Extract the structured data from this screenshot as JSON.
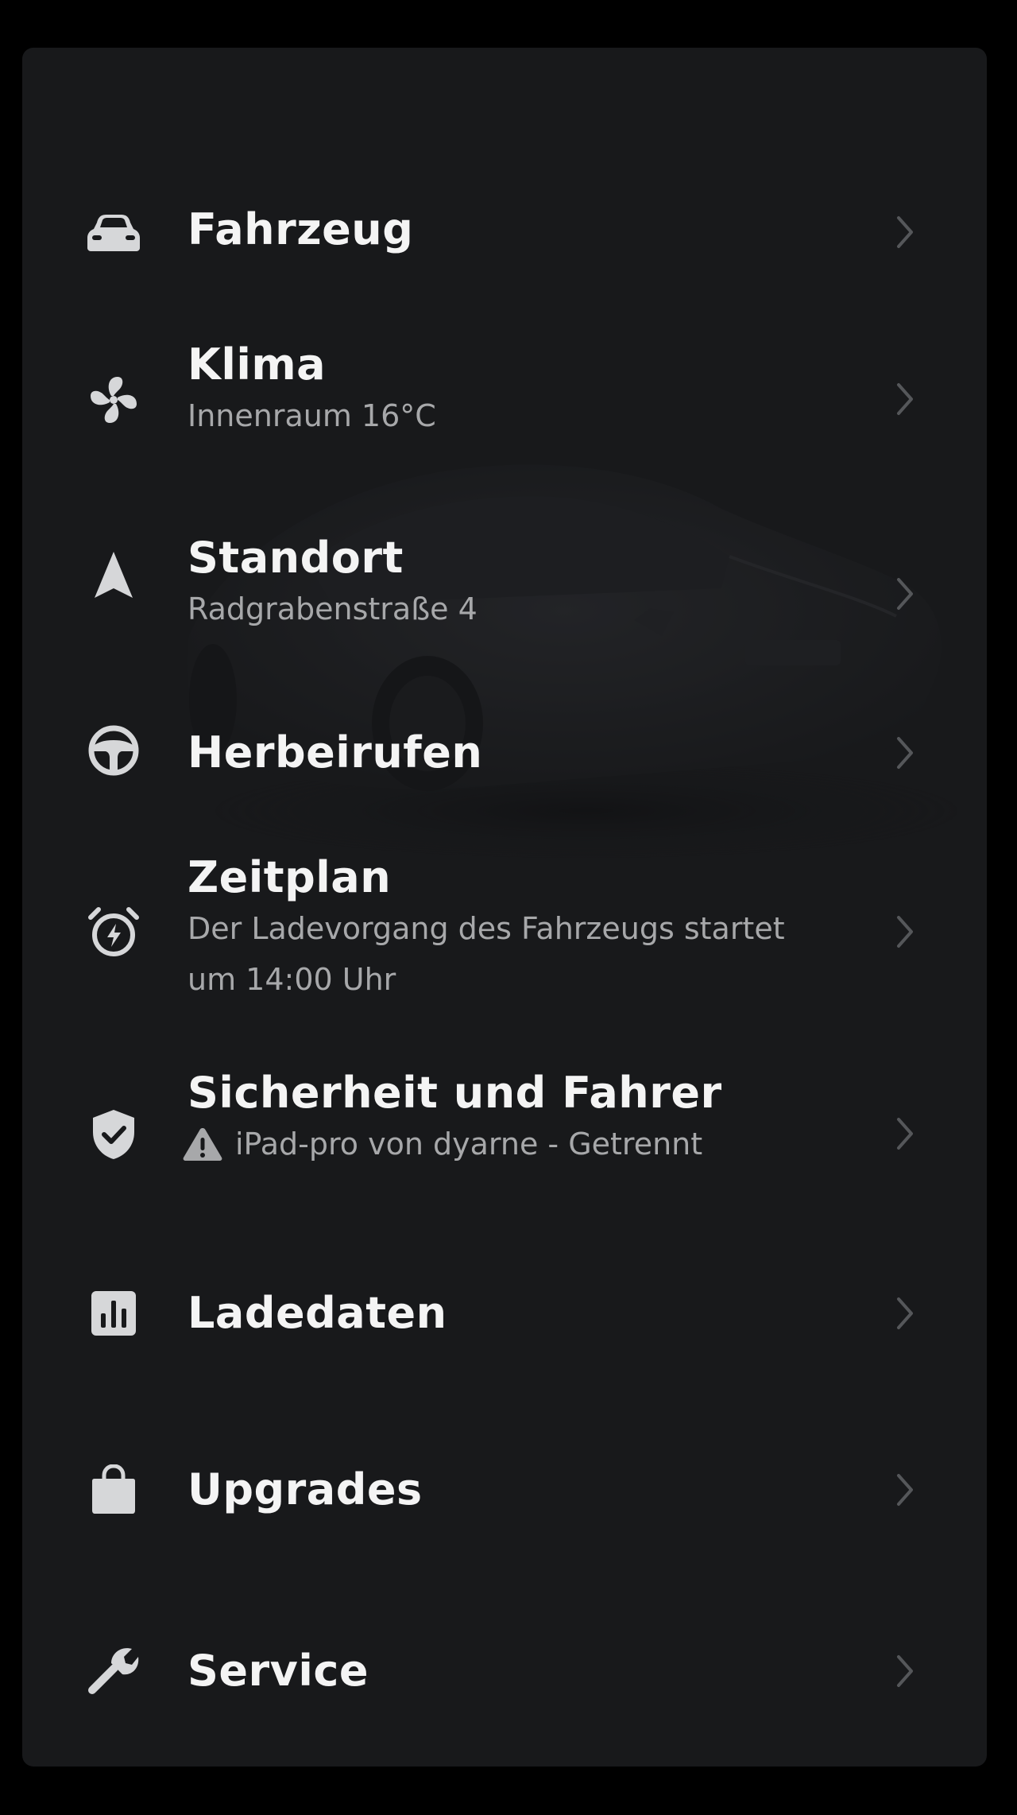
{
  "colors": {
    "background": "#000000",
    "panel": "#18191b",
    "title_text": "#f4f4f4",
    "subtitle_text": "#a7a8aa",
    "icon": "#d6d7d9",
    "chevron": "#55575a"
  },
  "menu": {
    "items": [
      {
        "id": "vehicle",
        "icon": "car-icon",
        "title": "Fahrzeug"
      },
      {
        "id": "climate",
        "icon": "fan-icon",
        "title": "Klima",
        "subtitle": "Innenraum 16°C"
      },
      {
        "id": "location",
        "icon": "navigation-arrow-icon",
        "title": "Standort",
        "subtitle": "Radgrabenstraße 4"
      },
      {
        "id": "summon",
        "icon": "steering-wheel-icon",
        "title": "Herbeirufen"
      },
      {
        "id": "schedule",
        "icon": "alarm-clock-bolt-icon",
        "title": "Zeitplan",
        "subtitle": "Der Ladevorgang des Fahrzeugs startet um 14:00 Uhr"
      },
      {
        "id": "security",
        "icon": "shield-check-icon",
        "title": "Sicherheit und Fahrer",
        "subtitle": "iPad-pro von dyarne - Getrennt",
        "subtitle_icon": "warning-triangle-icon"
      },
      {
        "id": "charging",
        "icon": "bar-chart-icon",
        "title": "Ladedaten"
      },
      {
        "id": "upgrades",
        "icon": "shopping-bag-icon",
        "title": "Upgrades"
      },
      {
        "id": "service",
        "icon": "wrench-icon",
        "title": "Service"
      }
    ]
  }
}
